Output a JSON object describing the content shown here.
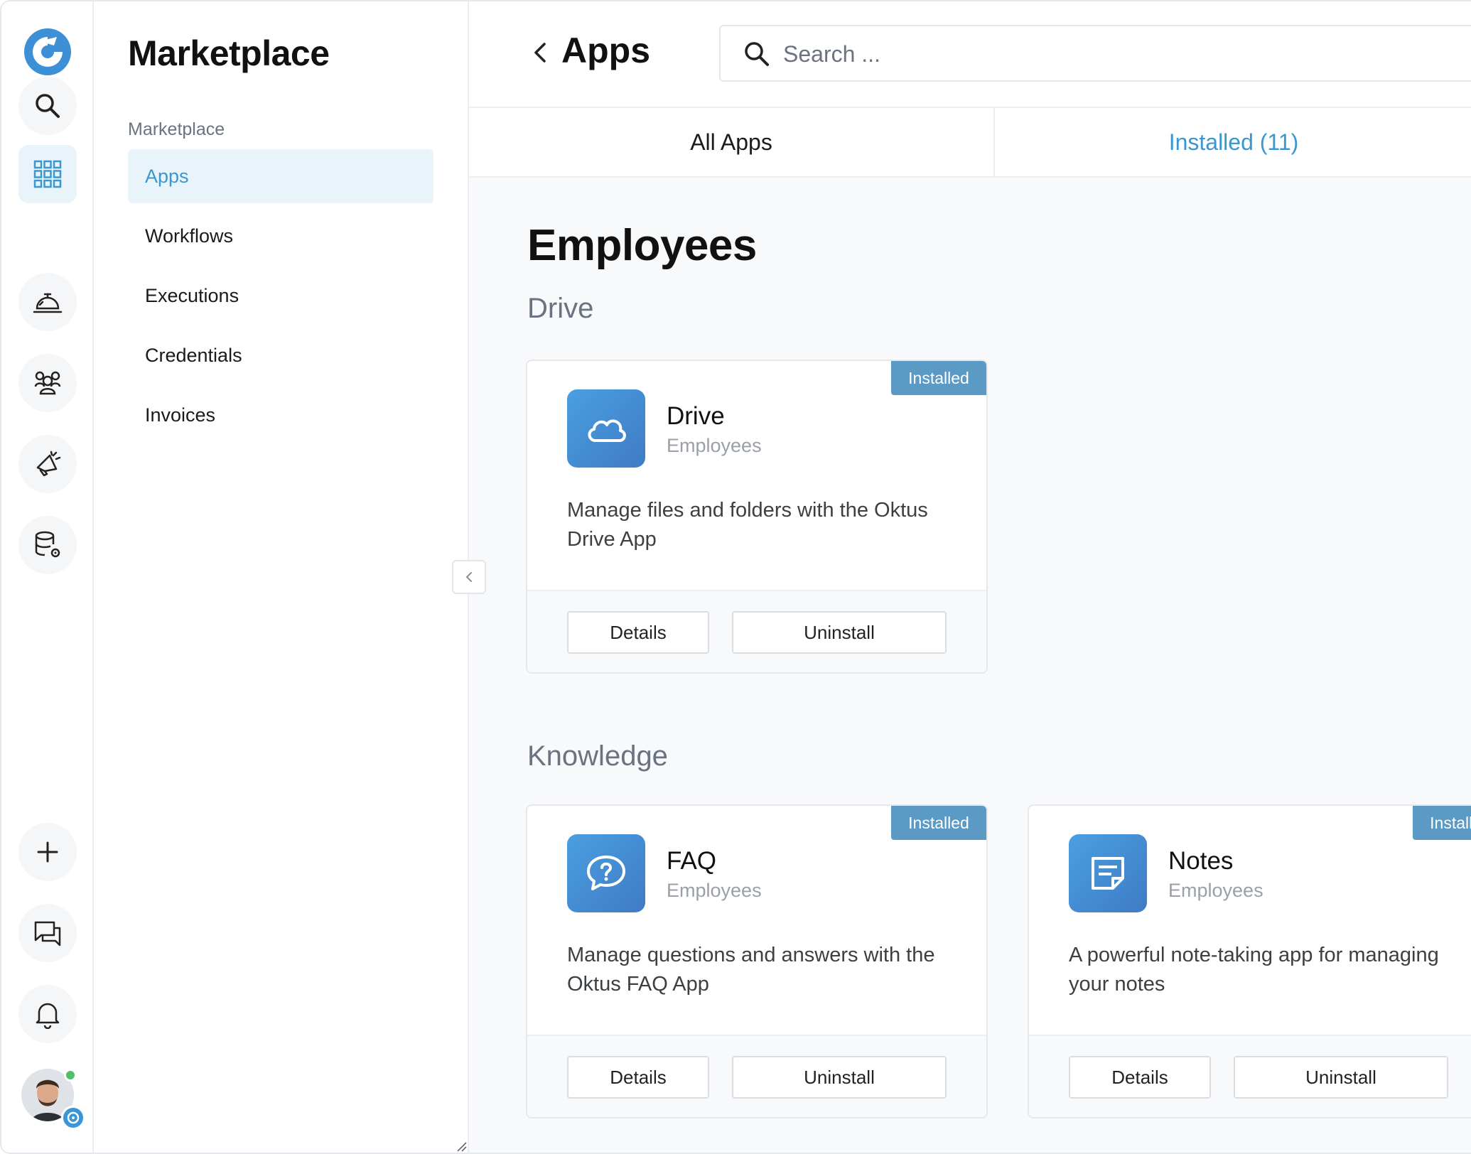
{
  "rail": {
    "items": [
      "search-icon",
      "apps-grid-icon",
      "service-bell-icon",
      "team-icon",
      "megaphone-icon",
      "database-settings-icon"
    ],
    "bottom": [
      "plus-icon",
      "chat-icon",
      "bell-icon"
    ],
    "active": "apps-grid-icon"
  },
  "sidebar": {
    "title": "Marketplace",
    "group_label": "Marketplace",
    "items": [
      {
        "label": "Apps",
        "active": true
      },
      {
        "label": "Workflows",
        "active": false
      },
      {
        "label": "Executions",
        "active": false
      },
      {
        "label": "Credentials",
        "active": false
      },
      {
        "label": "Invoices",
        "active": false
      }
    ]
  },
  "header": {
    "title": "Apps",
    "search_placeholder": "Search ..."
  },
  "tabs": [
    {
      "label": "All Apps",
      "selected": false
    },
    {
      "label": "Installed (11)",
      "selected": true
    }
  ],
  "section": {
    "title": "Employees",
    "categories": [
      {
        "name": "Drive",
        "apps": [
          {
            "name": "Drive",
            "category": "Employees",
            "badge": "Installed",
            "icon": "cloud-icon",
            "description": "Manage files and folders with the Oktus Drive App",
            "details_label": "Details",
            "uninstall_label": "Uninstall"
          }
        ]
      },
      {
        "name": "Knowledge",
        "apps": [
          {
            "name": "FAQ",
            "category": "Employees",
            "badge": "Installed",
            "icon": "faq-bubble-icon",
            "description": "Manage questions and answers with the Oktus FAQ App",
            "details_label": "Details",
            "uninstall_label": "Uninstall"
          },
          {
            "name": "Notes",
            "category": "Employees",
            "badge": "Installed",
            "icon": "note-icon",
            "description": "A powerful note-taking app for managing your notes",
            "details_label": "Details",
            "uninstall_label": "Uninstall"
          }
        ]
      }
    ]
  },
  "colors": {
    "accent": "#3a97cf",
    "badge": "#5b9ac4",
    "active_bg": "#e8f4fa",
    "online": "#4fbf6c"
  }
}
